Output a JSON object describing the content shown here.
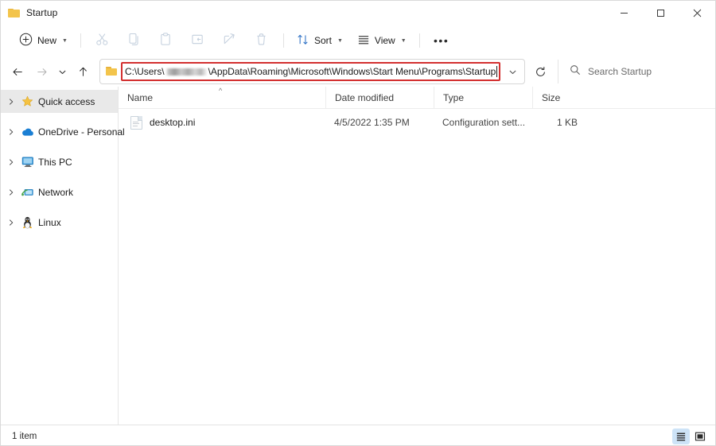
{
  "window": {
    "title": "Startup",
    "folder_icon": "folder-icon",
    "controls": {
      "minimize": "Minimize",
      "maximize": "Maximize",
      "close": "Close"
    }
  },
  "toolbar": {
    "new_label": "New",
    "items": [
      {
        "name": "cut-icon",
        "label": "Cut"
      },
      {
        "name": "copy-icon",
        "label": "Copy"
      },
      {
        "name": "paste-icon",
        "label": "Paste"
      },
      {
        "name": "rename-icon",
        "label": "Rename"
      },
      {
        "name": "share-icon",
        "label": "Share"
      },
      {
        "name": "delete-icon",
        "label": "Delete"
      }
    ],
    "sort_label": "Sort",
    "view_label": "View",
    "more_label": "See more"
  },
  "navigation": {
    "back": "Back",
    "forward": "Forward",
    "recent": "Recent locations",
    "up": "Up to Programs",
    "refresh": "Refresh"
  },
  "address": {
    "prefix": "C:\\Users\\",
    "redacted": "",
    "suffix": "\\AppData\\Roaming\\Microsoft\\Windows\\Start Menu\\Programs\\Startup",
    "highlight_color": "#d32f2f",
    "dropdown": "Previous locations"
  },
  "search": {
    "placeholder": "Search Startup"
  },
  "sidebar": {
    "items": [
      {
        "label": "Quick access",
        "icon": "star-icon",
        "selected": true
      },
      {
        "label": "OneDrive - Personal",
        "icon": "cloud-icon",
        "selected": false
      },
      {
        "label": "This PC",
        "icon": "monitor-icon",
        "selected": false
      },
      {
        "label": "Network",
        "icon": "network-icon",
        "selected": false
      },
      {
        "label": "Linux",
        "icon": "penguin-icon",
        "selected": false
      }
    ]
  },
  "filelist": {
    "columns": [
      {
        "label": "Name",
        "sorted": "ascending"
      },
      {
        "label": "Date modified",
        "sorted": ""
      },
      {
        "label": "Type",
        "sorted": ""
      },
      {
        "label": "Size",
        "sorted": ""
      }
    ],
    "sort_glyph": "^",
    "rows": [
      {
        "name": "desktop.ini",
        "icon": "ini-file-icon",
        "date_modified": "4/5/2022 1:35 PM",
        "type": "Configuration sett...",
        "size": "1 KB"
      }
    ]
  },
  "statusbar": {
    "item_count": "1 item",
    "views": [
      {
        "name": "details-view-button",
        "label": "Details view",
        "active": true
      },
      {
        "name": "large-icons-view-button",
        "label": "Large icons view",
        "active": false
      }
    ]
  }
}
